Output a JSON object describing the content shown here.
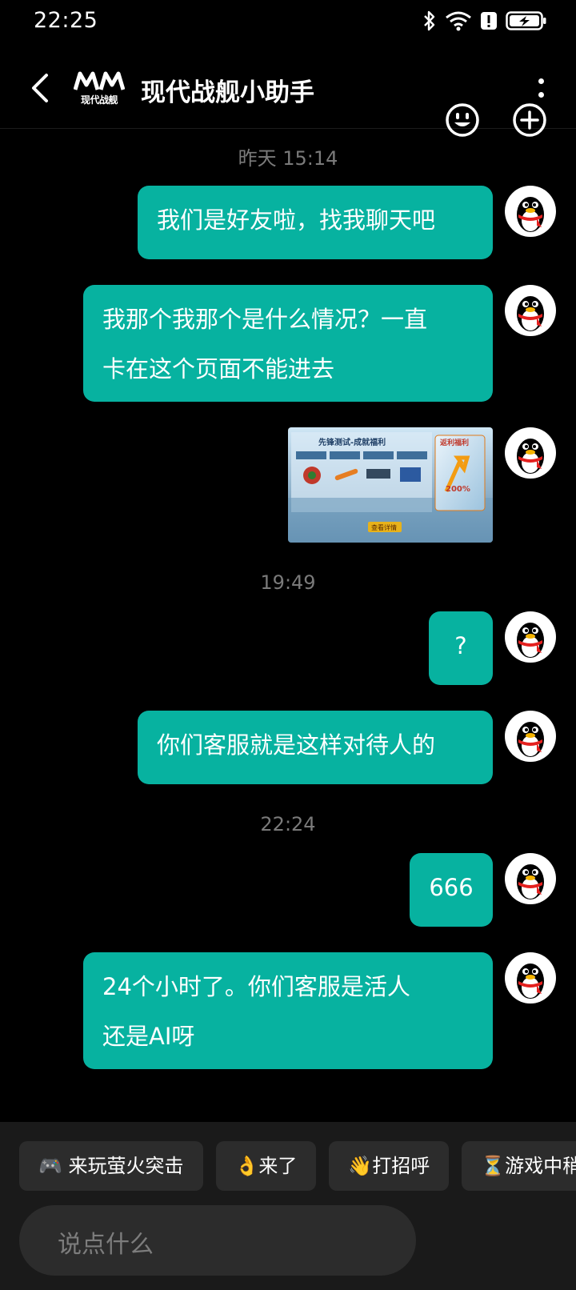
{
  "status_bar": {
    "time": "22:25",
    "icons": [
      "bluetooth-icon",
      "wifi-icon",
      "alert-icon",
      "battery-charging-icon"
    ]
  },
  "header": {
    "title": "现代战舰小助手",
    "logo_text": "现代战舰",
    "icons": [
      "back-arrow-icon",
      "more-vertical-icon"
    ]
  },
  "chat": {
    "timestamps": [
      "昨天  15:14",
      "19:49",
      "22:24"
    ],
    "messages": [
      {
        "type": "text",
        "lines": [
          "我们是好友啦，找我聊天吧"
        ]
      },
      {
        "type": "text",
        "lines": [
          "我那个我那个是什么情况？一直",
          "卡在这个页面不能进去"
        ]
      },
      {
        "type": "image",
        "caption_title": "先锋测试-成就福利",
        "caption_side": "返利福利",
        "percent": "200%",
        "button": "查看详情"
      },
      {
        "type": "text",
        "lines": [
          "?"
        ]
      },
      {
        "type": "text",
        "lines": [
          "你们客服就是这样对待人的"
        ]
      },
      {
        "type": "text",
        "lines": [
          "666"
        ]
      },
      {
        "type": "text",
        "lines": [
          "24个小时了。你们客服是活人",
          "还是AI呀"
        ]
      }
    ]
  },
  "quick_replies": [
    "🎮 来玩萤火突击",
    "👌来了",
    "👋打招呼",
    "⏳游戏中稍后"
  ],
  "input": {
    "placeholder": "说点什么",
    "icons": [
      "emoji-icon",
      "plus-circle-icon"
    ]
  },
  "colors": {
    "bubble": "#07b2a0",
    "background": "#000000",
    "panel": "#1a1a1a"
  }
}
